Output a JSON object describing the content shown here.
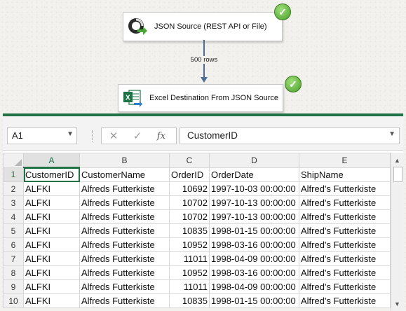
{
  "dataflow": {
    "source_task": {
      "label": "JSON Source (REST API or File)",
      "status": "success",
      "icon": "json-source-icon"
    },
    "destination_task": {
      "label": "Excel Destination From JSON Source",
      "status": "success",
      "icon": "excel-destination-icon"
    },
    "path_label": "500 rows",
    "colors": {
      "path": "#4d6e95",
      "success": "#4a9d2a"
    }
  },
  "sheet": {
    "name_box": "A1",
    "formula_value": "CustomerID",
    "accent_color": "#217346",
    "column_letters": [
      "A",
      "B",
      "C",
      "D",
      "E"
    ],
    "row_numbers": [
      "1",
      "2",
      "3",
      "4",
      "5",
      "6",
      "7",
      "8",
      "9",
      "10"
    ],
    "rows": [
      [
        "CustomerID",
        "CustomerName",
        "OrderID",
        "OrderDate",
        "ShipName"
      ],
      [
        "ALFKI",
        "Alfreds Futterkiste",
        "10692",
        "1997-10-03 00:00:00",
        "Alfred's Futterkiste"
      ],
      [
        "ALFKI",
        "Alfreds Futterkiste",
        "10702",
        "1997-10-13 00:00:00",
        "Alfred's Futterkiste"
      ],
      [
        "ALFKI",
        "Alfreds Futterkiste",
        "10702",
        "1997-10-13 00:00:00",
        "Alfred's Futterkiste"
      ],
      [
        "ALFKI",
        "Alfreds Futterkiste",
        "10835",
        "1998-01-15 00:00:00",
        "Alfred's Futterkiste"
      ],
      [
        "ALFKI",
        "Alfreds Futterkiste",
        "10952",
        "1998-03-16 00:00:00",
        "Alfred's Futterkiste"
      ],
      [
        "ALFKI",
        "Alfreds Futterkiste",
        "11011",
        "1998-04-09 00:00:00",
        "Alfred's Futterkiste"
      ],
      [
        "ALFKI",
        "Alfreds Futterkiste",
        "10952",
        "1998-03-16 00:00:00",
        "Alfred's Futterkiste"
      ],
      [
        "ALFKI",
        "Alfreds Futterkiste",
        "11011",
        "1998-04-09 00:00:00",
        "Alfred's Futterkiste"
      ],
      [
        "ALFKI",
        "Alfreds Futterkiste",
        "10835",
        "1998-01-15 00:00:00",
        "Alfred's Futterkiste"
      ]
    ]
  }
}
